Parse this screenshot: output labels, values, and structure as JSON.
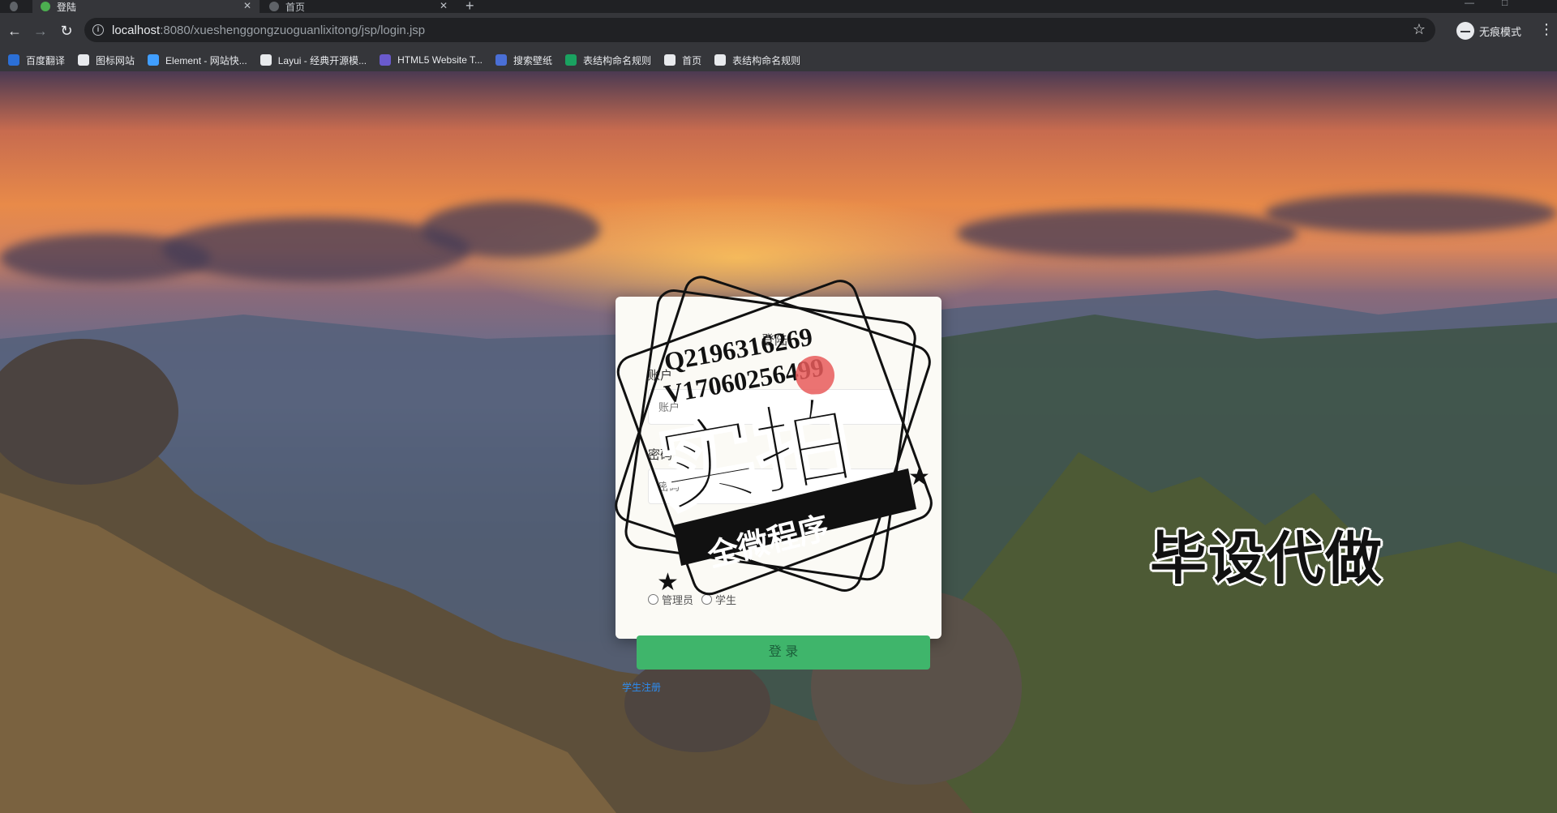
{
  "browser": {
    "tabs": [
      {
        "title": "登陆",
        "active": true
      },
      {
        "title": "首页",
        "active": false
      }
    ],
    "url_host": "localhost",
    "url_path": ":8080/xueshenggongzuoguanlixitong/jsp/login.jsp",
    "incognito_label": "无痕模式",
    "bookmarks": [
      {
        "label": "百度翻译",
        "color": "#2b6fd6"
      },
      {
        "label": "图标网站",
        "color": "#e8eaed"
      },
      {
        "label": "Element - 网站快...",
        "color": "#409eff"
      },
      {
        "label": "Layui - 经典开源模...",
        "color": "#e8eaed"
      },
      {
        "label": "HTML5 Website T...",
        "color": "#6a5acd"
      },
      {
        "label": "搜索壁纸",
        "color": "#4a6fd6"
      },
      {
        "label": "表结构命名规则",
        "color": "#1aa260"
      },
      {
        "label": "首页",
        "color": "#e8eaed"
      },
      {
        "label": "表结构命名规则",
        "color": "#e8eaed"
      }
    ]
  },
  "login": {
    "title": "登陆",
    "account_label": "账户",
    "account_placeholder": "账户",
    "password_label": "密码",
    "password_placeholder": "密码",
    "role_admin": "管理员",
    "role_student": "学生",
    "submit": "登 录",
    "register": "学生注册"
  },
  "watermark": {
    "line1": "Q2196316269",
    "line2": "V17060256499",
    "big": "实拍",
    "ribbon": "全微程序",
    "bottom": "毕设代做"
  }
}
